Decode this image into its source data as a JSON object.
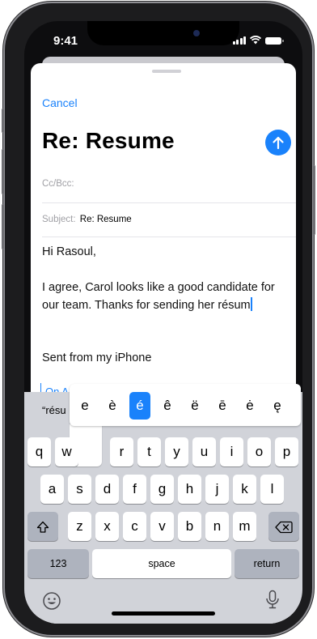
{
  "status": {
    "time": "9:41"
  },
  "compose": {
    "cancel_label": "Cancel",
    "title": "Re: Resume",
    "cc_label": "Cc/Bcc:",
    "subject_label": "Subject:",
    "subject_value": "Re: Resume",
    "greeting": "Hi Rasoul,",
    "body_line1": "I agree, Carol looks like a good candidate for",
    "body_line2": "our team. Thanks for sending her résum",
    "signature": "Sent from my iPhone",
    "quoted_partial": "On A"
  },
  "keyboard": {
    "prediction": "“résu",
    "accent_options": [
      "e",
      "è",
      "é",
      "ê",
      "ë",
      "ē",
      "ė",
      "ę"
    ],
    "selected_accent": "é",
    "row1": [
      "q",
      "w",
      "e",
      "r",
      "t",
      "y",
      "u",
      "i",
      "o",
      "p"
    ],
    "row2": [
      "a",
      "s",
      "d",
      "f",
      "g",
      "h",
      "j",
      "k",
      "l"
    ],
    "row3": [
      "z",
      "x",
      "c",
      "v",
      "b",
      "n",
      "m"
    ],
    "numbers_label": "123",
    "space_label": "space",
    "return_label": "return"
  },
  "icons": {
    "send": "arrow-up-icon",
    "shift": "shift-icon",
    "delete": "delete-icon",
    "emoji": "emoji-icon",
    "mic": "microphone-icon"
  },
  "colors": {
    "accent": "#1a82fb",
    "keyboard_bg": "#d1d3d9"
  }
}
